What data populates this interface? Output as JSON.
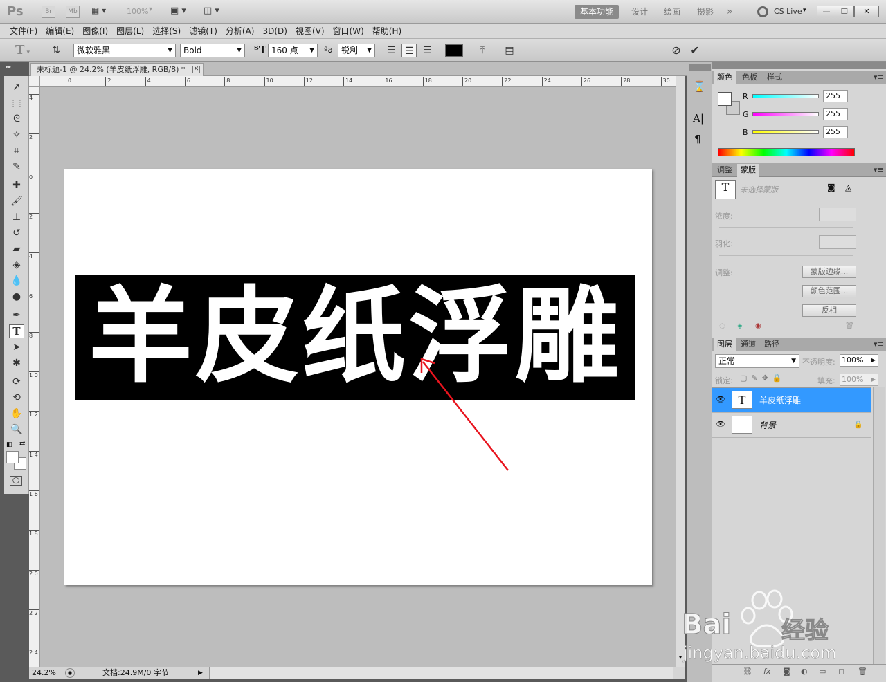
{
  "app": {
    "logo": "Ps",
    "br": "Br",
    "mb": "Mb",
    "zoom": "100%",
    "workspaces": [
      "基本功能",
      "设计",
      "绘画",
      "摄影"
    ],
    "more": "»",
    "cslive": "CS Live"
  },
  "menu": [
    "文件(F)",
    "编辑(E)",
    "图像(I)",
    "图层(L)",
    "选择(S)",
    "滤镜(T)",
    "分析(A)",
    "3D(D)",
    "视图(V)",
    "窗口(W)",
    "帮助(H)"
  ],
  "options": {
    "font_family": "微软雅黑",
    "font_style": "Bold",
    "font_size": "160 点",
    "antialias": "锐利"
  },
  "document": {
    "tab_title": "未标题-1 @ 24.2% (羊皮纸浮雕, RGB/8) *",
    "text": "羊皮纸浮雕"
  },
  "rulers": {
    "h": [
      "0",
      "2",
      "4",
      "6",
      "8",
      "10",
      "12",
      "14",
      "16",
      "18",
      "20",
      "22",
      "24",
      "26",
      "28",
      "30"
    ],
    "v": [
      "4",
      "2",
      "0",
      "2",
      "4",
      "6",
      "8",
      "1 0",
      "1 2",
      "1 4",
      "1 6",
      "1 8",
      "2 0",
      "2 2",
      "2 4"
    ]
  },
  "status": {
    "zoom": "24.2%",
    "doc": "文档:24.9M/0 字节"
  },
  "color_panel": {
    "tabs": [
      "颜色",
      "色板",
      "样式"
    ],
    "channels": [
      {
        "label": "R",
        "value": "255"
      },
      {
        "label": "G",
        "value": "255"
      },
      {
        "label": "B",
        "value": "255"
      }
    ]
  },
  "mask_panel": {
    "tabs": [
      "调整",
      "蒙版"
    ],
    "no_mask": "未选择蒙版",
    "density": "浓度:",
    "feather": "羽化:",
    "refine": "调整:",
    "buttons": [
      "蒙版边缘...",
      "颜色范围...",
      "反相"
    ]
  },
  "layers_panel": {
    "tabs": [
      "图层",
      "通道",
      "路径"
    ],
    "blend": "正常",
    "opacity_label": "不透明度:",
    "opacity": "100%",
    "lock_label": "锁定:",
    "fill_label": "填充:",
    "fill": "100%",
    "layers": [
      {
        "name": "羊皮纸浮雕",
        "thumb": "T",
        "selected": true
      },
      {
        "name": "背景",
        "thumb": "",
        "selected": false
      }
    ]
  },
  "watermark": {
    "brand": "Bai",
    "brand2": "经验",
    "url": "jingyan.baidu.com"
  },
  "colors": {
    "accent": "#3399ff",
    "annotation": "#e8141e"
  }
}
